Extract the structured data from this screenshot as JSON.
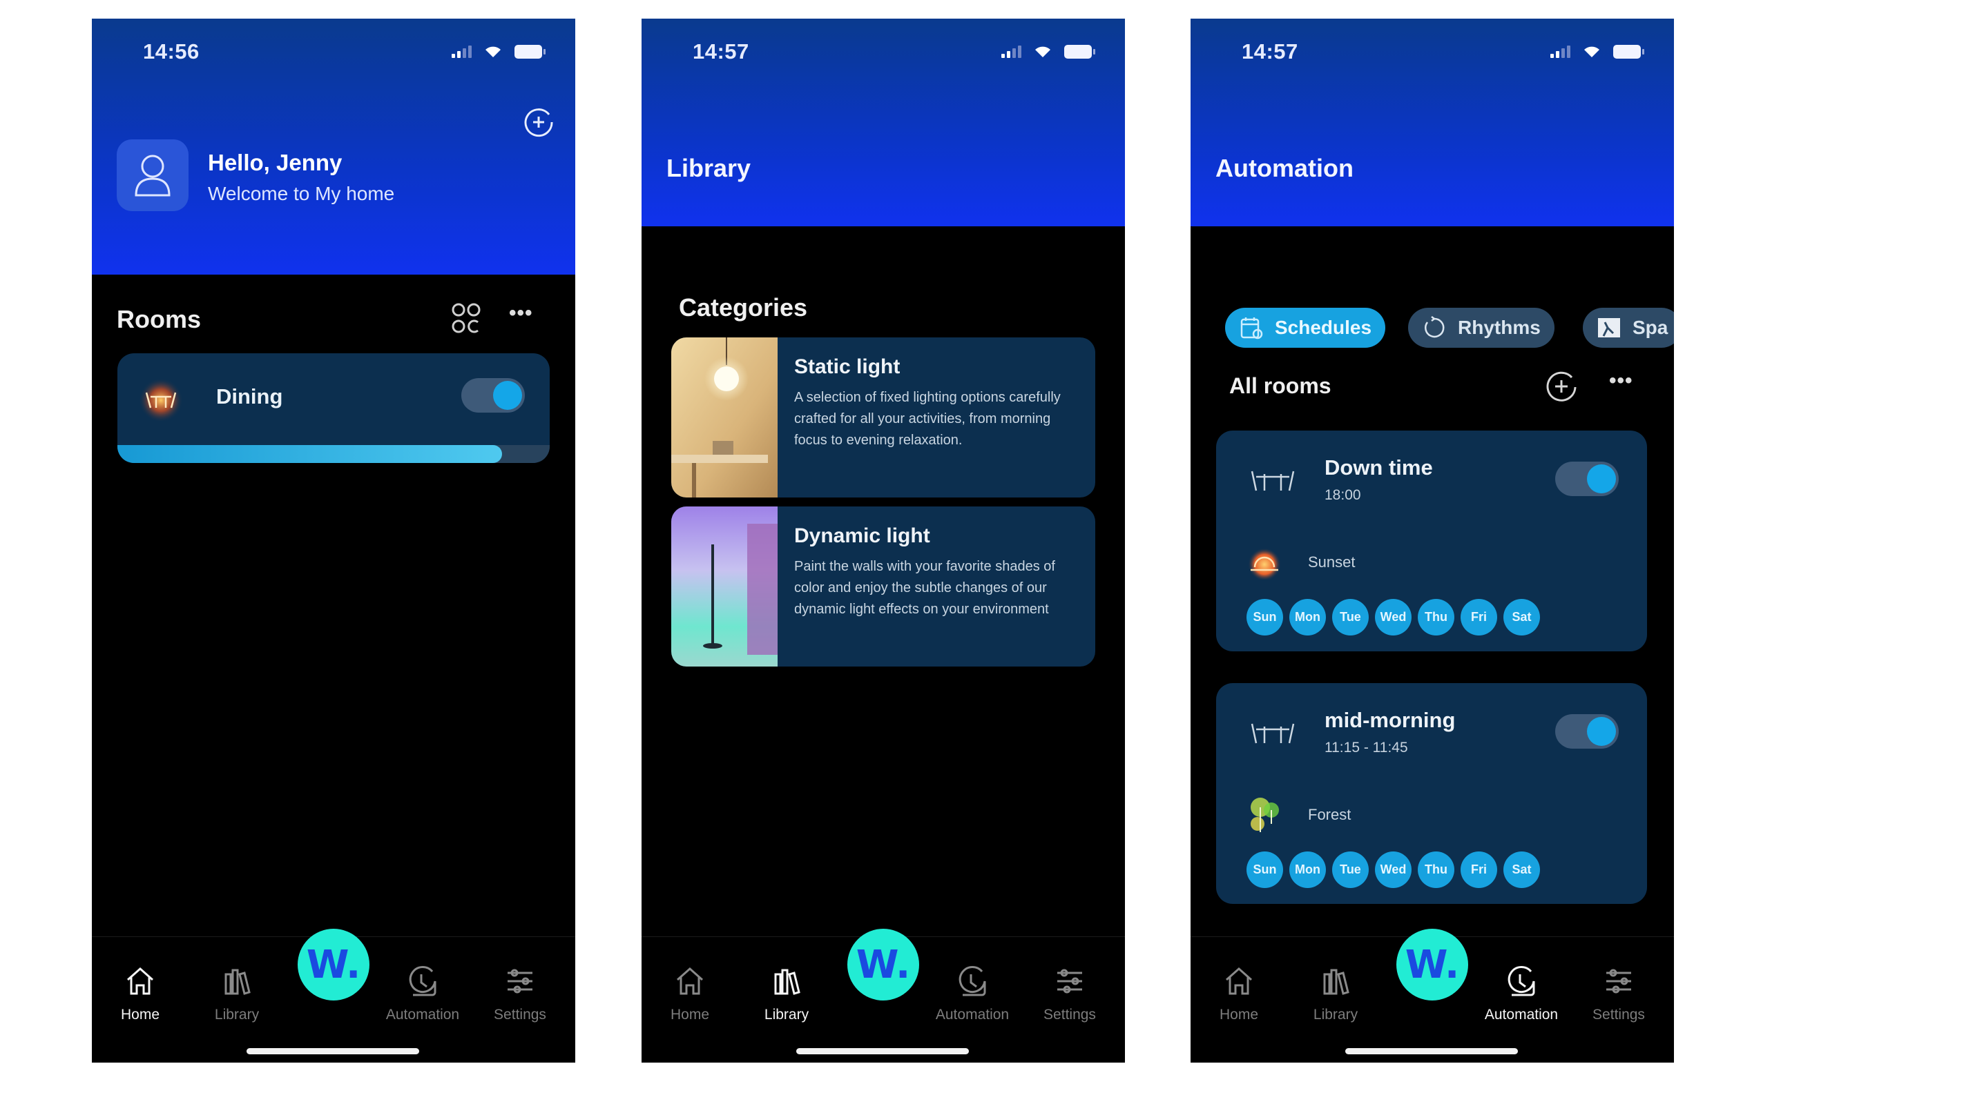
{
  "screens": {
    "home": {
      "status": {
        "time": "14:56"
      },
      "greeting": {
        "title": "Hello, Jenny",
        "subtitle": "Welcome to My home"
      },
      "rooms": {
        "title": "Rooms",
        "items": [
          {
            "name": "Dining",
            "icon": "dining-table-icon",
            "on": true,
            "brightness_percent": 89
          }
        ]
      }
    },
    "library": {
      "status": {
        "time": "14:57"
      },
      "title": "Library",
      "categories_title": "Categories",
      "categories": [
        {
          "title": "Static light",
          "description": "A selection of fixed lighting options carefully crafted for all your activities, from morning focus to evening relaxation."
        },
        {
          "title": "Dynamic light",
          "description": "Paint the walls with your favorite shades of color and enjoy the subtle changes of our dynamic light effects on your environment"
        }
      ]
    },
    "automation": {
      "status": {
        "time": "14:57"
      },
      "title": "Automation",
      "tabs": [
        {
          "label": "Schedules",
          "icon": "calendar-icon",
          "active": true
        },
        {
          "label": "Rhythms",
          "icon": "rhythm-cycle-icon",
          "active": false
        },
        {
          "label": "Spa",
          "icon": "space-icon",
          "active": false
        }
      ],
      "section_title": "All rooms",
      "schedules": [
        {
          "name": "Down time",
          "time": "18:00",
          "scene": "Sunset",
          "scene_icon": "sunset-icon",
          "on": true,
          "days": [
            "Sun",
            "Mon",
            "Tue",
            "Wed",
            "Thu",
            "Fri",
            "Sat"
          ]
        },
        {
          "name": "mid-morning",
          "time": "11:15 - 11:45",
          "scene": "Forest",
          "scene_icon": "forest-icon",
          "on": true,
          "days": [
            "Sun",
            "Mon",
            "Tue",
            "Wed",
            "Thu",
            "Fri",
            "Sat"
          ]
        }
      ]
    }
  },
  "nav": {
    "items": [
      "Home",
      "Library",
      "Automation",
      "Settings"
    ],
    "fab_label": "W."
  },
  "colors": {
    "header_blue": "#0b35c8",
    "card_bg": "#0c2f4f",
    "accent": "#17a2e0",
    "fab": "#22ecd4"
  }
}
